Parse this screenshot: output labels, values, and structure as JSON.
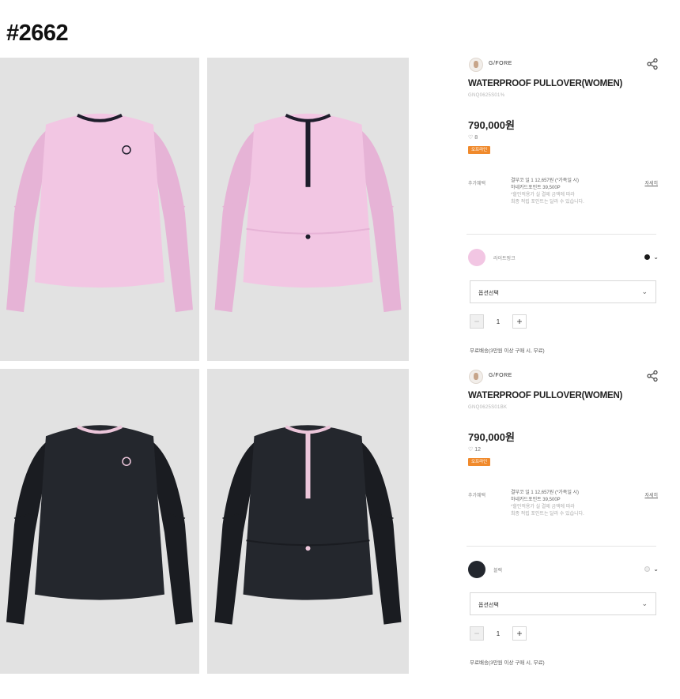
{
  "doc_title": "#2662",
  "products": [
    {
      "brand": "G/FORE",
      "icons": {
        "logo": "brand-logo-icon",
        "share": "share-icon"
      },
      "name": "WATERPROOF PULLOVER(WOMEN)",
      "code": "GNQ0625S01%",
      "price": "790,000원",
      "likes": "♡ 8",
      "badge": "오프라인",
      "info": {
        "label": "추가혜택",
        "line1": "결부코 일 1 12,657원 (*가족일 시)",
        "line2": "하네카드포인트 39,500P",
        "note1": "*할인적용가 실 결제 금액에 따라",
        "note2": "최종 적립 포인트는 달라 수 있습니다.",
        "link": "자세히"
      },
      "color_label": "라이트핑크",
      "swatch_color": "#f2c6e3",
      "options": [
        {
          "color": "#1a1a1a",
          "selected": false
        }
      ],
      "select_value": "옵션선택",
      "quantity": "1",
      "shipping": "무료배송(3만원 이상 구매 시, 무료)"
    },
    {
      "brand": "G/FORE",
      "icons": {
        "logo": "brand-logo-icon",
        "share": "share-icon"
      },
      "name": "WATERPROOF PULLOVER(WOMEN)",
      "code": "GNQ0625S01BK",
      "price": "790,000원",
      "likes": "♡ 12",
      "badge": "오프라인",
      "info": {
        "label": "추가혜택",
        "line1": "결부코 일 1 12,657원 (*가족일 시)",
        "line2": "하네카드포인트 39,500P",
        "note1": "*할인적용가 실 결제 금액에 따라",
        "note2": "최종 적립 포인트는 달라 수 있습니다.",
        "link": "자세히"
      },
      "color_label": "블랙",
      "swatch_color": "#23272e",
      "options": [
        {
          "color": "#eeeeee",
          "selected": false
        }
      ],
      "select_value": "옵션선택",
      "quantity": "1",
      "shipping": "무료배송(3만원 이상 구매 시, 무료)"
    }
  ],
  "photos": [
    {
      "label": "pink-front",
      "garment_color": "#f2c6e3",
      "shade": "#e6b3d6",
      "trim": "#1d1d2b",
      "view": "front"
    },
    {
      "label": "pink-back",
      "garment_color": "#f2c6e3",
      "shade": "#e6b3d6",
      "trim": "#1d1d2b",
      "view": "back"
    },
    {
      "label": "black-front",
      "garment_color": "#24272d",
      "shade": "#1a1c21",
      "trim": "#ecc6da",
      "view": "front"
    },
    {
      "label": "black-back",
      "garment_color": "#24272d",
      "shade": "#1a1c21",
      "trim": "#ecc6da",
      "view": "back"
    }
  ]
}
